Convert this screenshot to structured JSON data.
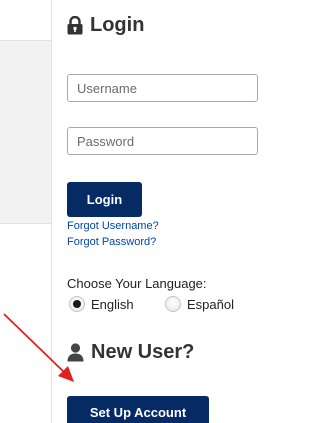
{
  "login": {
    "heading": "Login",
    "username_placeholder": "Username",
    "password_placeholder": "Password",
    "button_label": "Login",
    "forgot_username": "Forgot Username?",
    "forgot_password": "Forgot Password?"
  },
  "language": {
    "label": "Choose Your Language:",
    "options": [
      {
        "label": "English",
        "selected": true
      },
      {
        "label": "Español",
        "selected": false
      }
    ]
  },
  "new_user": {
    "heading": "New User?",
    "button_label": "Set Up Account"
  },
  "colors": {
    "button": "#062a63",
    "link": "#0047ab",
    "annotation_arrow": "#e02020"
  },
  "icons": {
    "login": "lock-icon",
    "new_user": "user-icon",
    "annotation": "red-arrow-icon"
  }
}
